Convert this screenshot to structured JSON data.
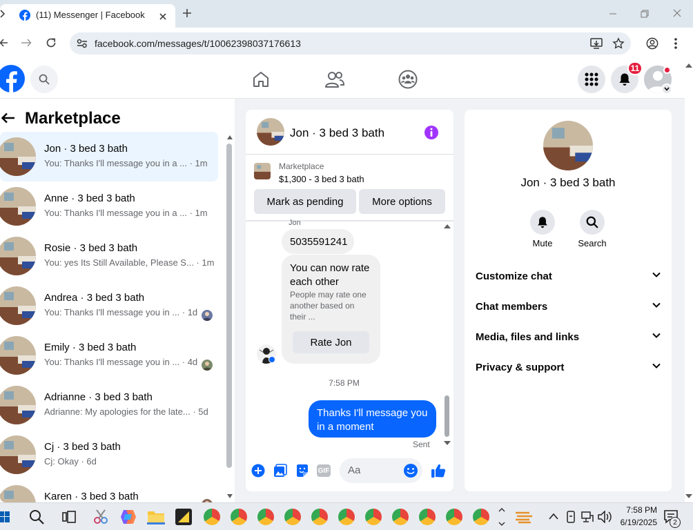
{
  "browser": {
    "tab_title": "(11) Messenger | Facebook",
    "url": "facebook.com/messages/t/10062398037176613"
  },
  "header": {
    "notification_count": "11"
  },
  "left_panel": {
    "title": "Marketplace",
    "conversations": [
      {
        "name": "Jon · 3 bed 3 bath",
        "snippet": "You: Thanks I'll message you in a ... · 1m",
        "selected": true
      },
      {
        "name": "Anne · 3 bed 3 bath",
        "snippet": "You: Thanks I'll message you in a ... · 1m"
      },
      {
        "name": "Rosie · 3 bed 3 bath",
        "snippet": "You: yes Its Still Available, Please S... · 1m"
      },
      {
        "name": "Andrea · 3 bed 3 bath",
        "snippet": "You: Thanks I'll message you in ... · 1d"
      },
      {
        "name": "Emily · 3 bed 3 bath",
        "snippet": "You: Thanks I'll message you in ... · 4d"
      },
      {
        "name": "Adrianne · 3 bed 3 bath",
        "snippet": "Adrianne: My apologies for the late... · 5d"
      },
      {
        "name": "Cj · 3 bed 3 bath",
        "snippet": "Cj: Okay · 6d"
      },
      {
        "name": "Karen · 3 bed 3 bath",
        "snippet": ""
      }
    ]
  },
  "chat": {
    "title": "Jon · 3 bed 3 bath",
    "listing_source": "Marketplace",
    "listing_info": "$1,300 - 3 bed 3 bath",
    "btn_pending": "Mark as pending",
    "btn_more": "More options",
    "sender_label": "Jon",
    "msg_phone": "5035591241",
    "rate_title": "You can now rate each other",
    "rate_desc": "People may rate one another based on their ...",
    "rate_button": "Rate Jon",
    "timestamp": "7:58 PM",
    "my_message": "Thanks I'll message you in a moment",
    "status": "Sent",
    "input_placeholder": "Aa"
  },
  "right_panel": {
    "name": "Jon · 3 bed 3 bath",
    "mute_label": "Mute",
    "search_label": "Search",
    "sections": [
      "Customize chat",
      "Chat members",
      "Media, files and links",
      "Privacy & support"
    ]
  },
  "taskbar": {
    "time": "7:58 PM",
    "date": "6/19/2025",
    "notif": "2"
  },
  "colors": {
    "fb_blue": "#0866ff",
    "messenger_purple": "#a033ff",
    "badge_red": "#e41e3f"
  }
}
